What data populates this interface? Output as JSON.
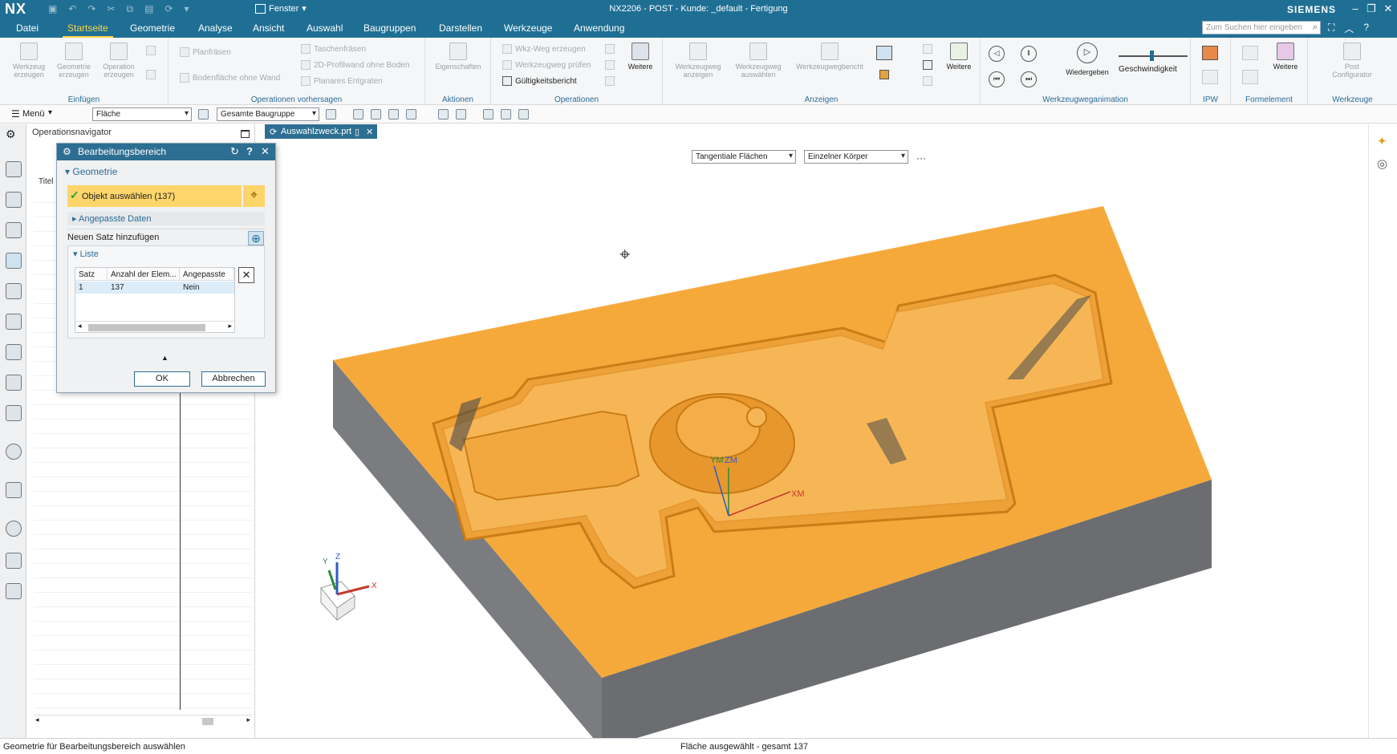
{
  "titlebar": {
    "logo": "NX",
    "window_menu": "Fenster",
    "title": "NX2206 - POST - Kunde: _default - Fertigung",
    "brand": "SIEMENS",
    "minimize": "–",
    "restore": "❐",
    "close": "✕"
  },
  "menu": {
    "tabs": [
      "Datei",
      "Startseite",
      "Geometrie",
      "Analyse",
      "Ansicht",
      "Auswahl",
      "Baugruppen",
      "Darstellen",
      "Werkzeuge",
      "Anwendung"
    ],
    "active_tab": "Startseite",
    "search_placeholder": "Zum Suchen hier eingeben"
  },
  "ribbon": {
    "einfuegen": {
      "name": "Einfügen",
      "werkzeug": "Werkzeug erzeugen",
      "geometrie": "Geometrie erzeugen",
      "operation": "Operation erzeugen"
    },
    "vorhersagen": {
      "name": "Operationen vorhersagen",
      "planfraesen": "Planfräsen",
      "bodenflaeche": "Bodenfläche ohne Wand",
      "taschenfraesen": "Taschenfräsen",
      "profilwand": "2D-Profilwand ohne Boden",
      "entgraten": "Planares Entgraten"
    },
    "aktionen": {
      "name": "Aktionen",
      "eigenschaften": "Eigenschaften"
    },
    "operationen": {
      "name": "Operationen",
      "wkz_weg_erzeugen": "Wkz-Weg erzeugen",
      "werkzeugweg_pruefen": "Werkzeugweg prüfen",
      "gueltigkeitsbericht": "Gültigkeitsbericht",
      "weitere": "Weitere"
    },
    "anzeigen": {
      "name": "Anzeigen",
      "werkzeugweg_anzeigen": "Werkzeugweg anzeigen",
      "werkzeugweg_auswaehlen": "Werkzeugweg auswählen",
      "werkzeugwegbericht": "Werkzeugwegbericht",
      "weitere": "Weitere"
    },
    "animation": {
      "name": "Werkzeugweganimation",
      "wiedergeben": "Wiedergeben",
      "geschwindigkeit": "Geschwindigkeit",
      "speed_level": 0.45
    },
    "ipw": {
      "name": "IPW"
    },
    "formelement": {
      "name": "Formelement",
      "weitere": "Weitere"
    },
    "werkzeuge": {
      "name": "Werkzeuge",
      "post": "Post Configurator"
    }
  },
  "selbar": {
    "menu": "Menü",
    "filter": "Fläche",
    "scope": "Gesamte Baugruppe"
  },
  "navigator": {
    "title": "Operationsnavigator",
    "col_title": "Titel"
  },
  "dialog": {
    "title": "Bearbeitungsbereich",
    "section_geometry": "Geometrie",
    "select_object": "Objekt auswählen (137)",
    "adapted_data": "Angepasste Daten",
    "new_set": "Neuen Satz hinzufügen",
    "list_title": "Liste",
    "columns": [
      "Satz",
      "Anzahl der Elem...",
      "Angepasste"
    ],
    "rows": [
      {
        "satz": "1",
        "anzahl": "137",
        "angepasst": "Nein"
      }
    ],
    "ok": "OK",
    "cancel": "Abbrechen"
  },
  "doc_tab": {
    "label": "Auswahlzweck.prt"
  },
  "viewport": {
    "filter_tangent": "Tangentiale Flächen",
    "filter_body": "Einzelner Körper",
    "more": "···",
    "csys_labels": {
      "ym": "YM",
      "zm": "ZM",
      "xm": "XM",
      "y": "Y",
      "z": "Z",
      "x": "X"
    },
    "colors": {
      "part_top": "#f5a93a",
      "part_side": "#77797c",
      "accent": "#1f6f94",
      "highlight": "#fdd56a"
    }
  },
  "status": {
    "left": "Geometrie für Bearbeitungsbereich auswählen",
    "center": "Fläche ausgewählt - gesamt 137"
  }
}
